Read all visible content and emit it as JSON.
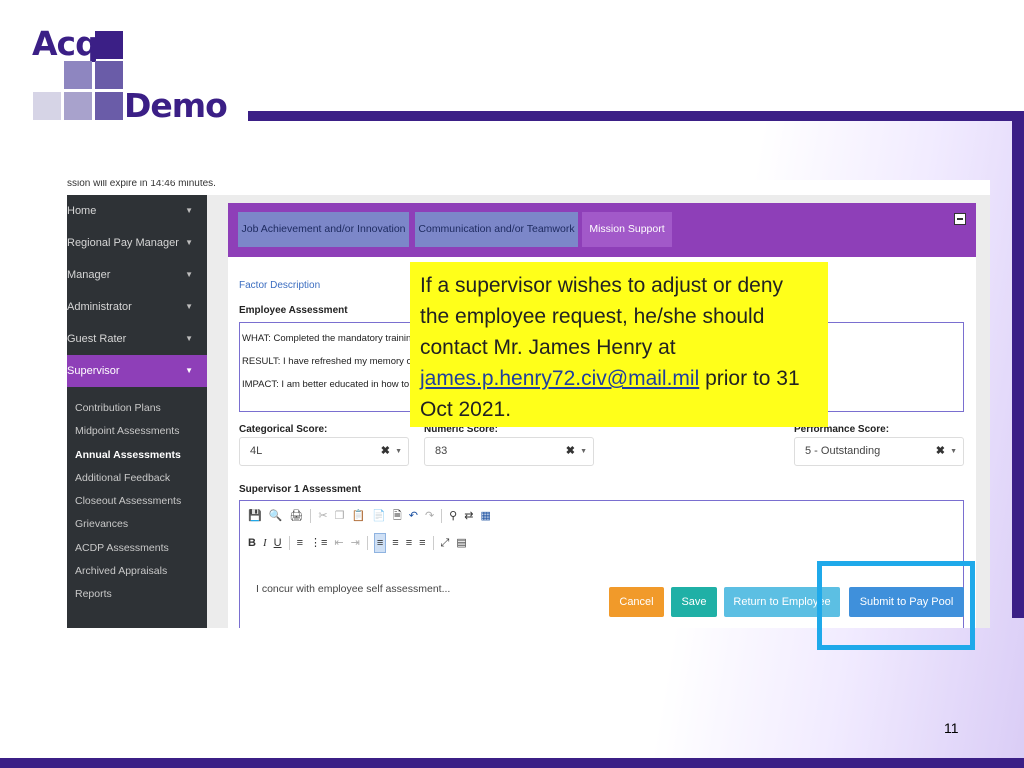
{
  "slide": {
    "logo_top": "Acq",
    "logo_bottom": "Demo",
    "brand_color": "#3b1f86",
    "page_number": "11"
  },
  "screenshot": {
    "session_text": "ssion will expire in 14:46 minutes.",
    "sidebar": {
      "items": [
        {
          "label": "Home"
        },
        {
          "label": "Regional Pay Manager"
        },
        {
          "label": "Manager"
        },
        {
          "label": "Administrator"
        },
        {
          "label": "Guest Rater"
        },
        {
          "label": "Supervisor"
        }
      ],
      "sub_items": [
        {
          "label": "Contribution Plans"
        },
        {
          "label": "Midpoint Assessments"
        },
        {
          "label": "Annual Assessments"
        },
        {
          "label": "Additional Feedback"
        },
        {
          "label": "Closeout Assessments"
        },
        {
          "label": "Grievances"
        },
        {
          "label": "ACDP Assessments"
        },
        {
          "label": "Archived Appraisals"
        },
        {
          "label": "Reports"
        }
      ]
    },
    "tabs": [
      {
        "label": "Job Achievement and/or Innovation"
      },
      {
        "label": "Communication and/or Teamwork"
      },
      {
        "label": "Mission Support"
      }
    ],
    "factor_description": "Factor Description",
    "employee_assessment": {
      "heading": "Employee Assessment",
      "what": "WHAT: Completed the mandatory training",
      "result": "RESULT: I have refreshed my memory on",
      "impact": "IMPACT: I am better educated in how to a"
    },
    "categorical": {
      "label": "Categorical Score:",
      "value": "4L"
    },
    "numeric": {
      "label": "Numeric Score:",
      "value": "83"
    },
    "performance": {
      "label": "Performance Score:",
      "value": "5 - Outstanding"
    },
    "supervisor_assessment": {
      "heading": "Supervisor 1 Assessment",
      "text": "I concur with employee self assessment..."
    },
    "buttons": {
      "cancel": "Cancel",
      "save": "Save",
      "return": "Return to Employee",
      "submit": "Submit to Pay Pool"
    }
  },
  "note": {
    "line1": "If a supervisor wishes to adjust or deny the employee request, he/she should contact Mr. James Henry at",
    "email": "james.p.henry72.civ@mail.mil",
    "line2": "prior to 31 Oct 2021."
  }
}
